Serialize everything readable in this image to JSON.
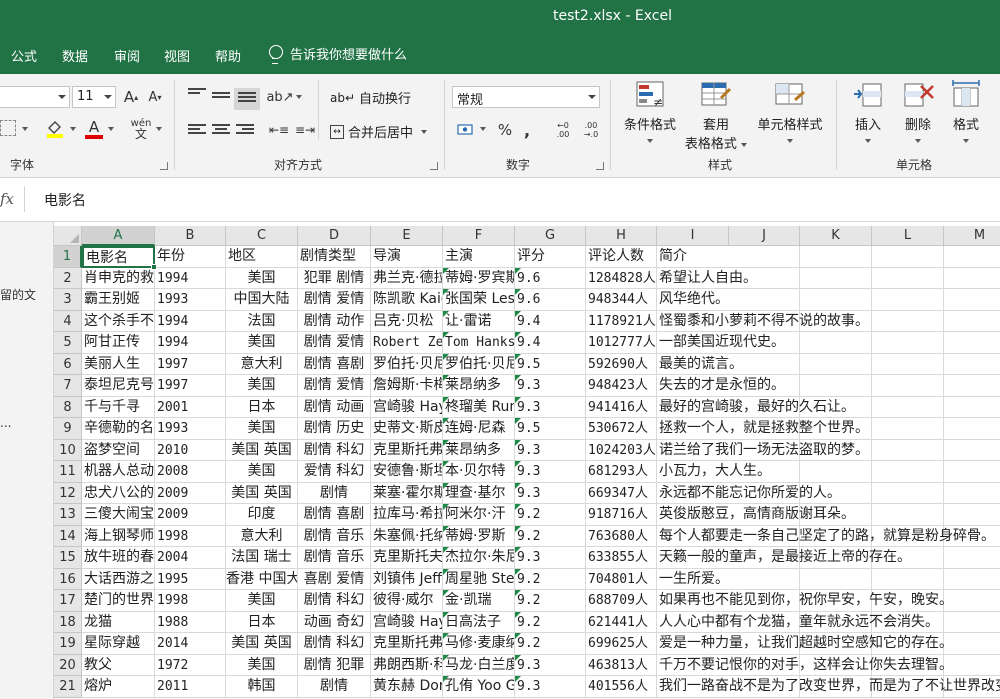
{
  "window": {
    "title": "test2.xlsx  -  Excel"
  },
  "menu": {
    "tabs": [
      "公式",
      "数据",
      "审阅",
      "视图",
      "帮助"
    ],
    "tell_me": "告诉我你想要做什么"
  },
  "ribbon": {
    "font_size": "11",
    "font_group": "字体",
    "wrap_text": "自动换行",
    "merge_center": "合并后居中",
    "align_group": "对齐方式",
    "number_format": "常规",
    "percent": "%",
    "comma": ",",
    "number_group": "数字",
    "cond_format": "条件格式",
    "table_format_1": "套用",
    "table_format_2": "表格格式",
    "cell_style": "单元格样式",
    "style_group": "样式",
    "insert": "插入",
    "delete": "删除",
    "format": "格式",
    "cells_group": "单元格"
  },
  "formula": {
    "fx": "fx",
    "value": "电影名"
  },
  "left_pane": {
    "items": [
      "留的文",
      "..."
    ]
  },
  "sheet": {
    "columns": [
      "A",
      "B",
      "C",
      "D",
      "E",
      "F",
      "G",
      "H",
      "I",
      "J",
      "K",
      "L",
      "M"
    ],
    "rows": [
      {
        "n": "1",
        "a": "电影名",
        "b": "年份",
        "c": "地区",
        "d": "剧情类型",
        "e": "导演",
        "f": "主演",
        "g": "评分",
        "h": "评论人数",
        "i": "简介"
      },
      {
        "n": "2",
        "a": "肖申克的救赎",
        "b": "1994",
        "c": "美国",
        "d": "犯罪 剧情",
        "e": "弗兰克·德拉邦特",
        "f": "蒂姆·罗宾斯",
        "g": "9.6",
        "h": "1284828人",
        "i": "希望让人自由。"
      },
      {
        "n": "3",
        "a": "霸王别姬",
        "b": "1993",
        "c": "中国大陆",
        "d": "剧情 爱情",
        "e": "陈凯歌 Kaige",
        "f": "张国荣 Leslie",
        "g": "9.6",
        "h": "948344人",
        "i": "风华绝代。"
      },
      {
        "n": "4",
        "a": "这个杀手不太冷",
        "b": "1994",
        "c": "法国",
        "d": "剧情 动作",
        "e": "吕克·贝松",
        "f": "让·雷诺",
        "g": "9.4",
        "h": "1178921人",
        "i": "怪蜀黍和小萝莉不得不说的故事。"
      },
      {
        "n": "5",
        "a": "阿甘正传",
        "b": "1994",
        "c": "美国",
        "d": "剧情 爱情",
        "e": "Robert Zemeckis",
        "f": "Tom Hanks",
        "g": "9.4",
        "h": "1012777人",
        "i": "一部美国近现代史。"
      },
      {
        "n": "6",
        "a": "美丽人生",
        "b": "1997",
        "c": "意大利",
        "d": "剧情 喜剧",
        "e": "罗伯托·贝尼尼",
        "f": "罗伯托·贝尼尼",
        "g": "9.5",
        "h": "592690人",
        "i": "最美的谎言。"
      },
      {
        "n": "7",
        "a": "泰坦尼克号",
        "b": "1997",
        "c": "美国",
        "d": "剧情 爱情",
        "e": "詹姆斯·卡梅隆",
        "f": "莱昂纳多",
        "g": "9.3",
        "h": "948423人",
        "i": "失去的才是永恒的。"
      },
      {
        "n": "8",
        "a": "千与千寻",
        "b": "2001",
        "c": "日本",
        "d": "剧情 动画",
        "e": "宫崎骏 Hayao",
        "f": "柊瑠美 Rumi",
        "g": "9.3",
        "h": "941416人",
        "i": "最好的宫崎骏，最好的久石让。"
      },
      {
        "n": "9",
        "a": "辛德勒的名单",
        "b": "1993",
        "c": "美国",
        "d": "剧情 历史",
        "e": "史蒂文·斯皮尔伯格",
        "f": "连姆·尼森",
        "g": "9.5",
        "h": "530672人",
        "i": "拯救一个人，就是拯救整个世界。"
      },
      {
        "n": "10",
        "a": "盗梦空间",
        "b": "2010",
        "c": "美国 英国",
        "d": "剧情 科幻",
        "e": "克里斯托弗·诺兰",
        "f": "莱昂纳多",
        "g": "9.3",
        "h": "1024203人",
        "i": "诺兰给了我们一场无法盗取的梦。"
      },
      {
        "n": "11",
        "a": "机器人总动员",
        "b": "2008",
        "c": "美国",
        "d": "爱情 科幻",
        "e": "安德鲁·斯坦顿",
        "f": "本·贝尔特",
        "g": "9.3",
        "h": "681293人",
        "i": "小瓦力，大人生。"
      },
      {
        "n": "12",
        "a": "忠犬八公的故事",
        "b": "2009",
        "c": "美国 英国",
        "d": "剧情",
        "e": "莱塞·霍尔斯道姆",
        "f": "理查·基尔",
        "g": "9.3",
        "h": "669347人",
        "i": "永远都不能忘记你所爱的人。"
      },
      {
        "n": "13",
        "a": "三傻大闹宝莱坞",
        "b": "2009",
        "c": "印度",
        "d": "剧情 喜剧",
        "e": "拉库马·希拉尼",
        "f": "阿米尔·汗",
        "g": "9.2",
        "h": "918716人",
        "i": "英俊版憨豆，高情商版谢耳朵。"
      },
      {
        "n": "14",
        "a": "海上钢琴师",
        "b": "1998",
        "c": "意大利",
        "d": "剧情 音乐",
        "e": "朱塞佩·托纳多雷",
        "f": "蒂姆·罗斯",
        "g": "9.2",
        "h": "763680人",
        "i": "每个人都要走一条自己坚定了的路，就算是粉身碎骨。"
      },
      {
        "n": "15",
        "a": "放牛班的春天",
        "b": "2004",
        "c": "法国 瑞士",
        "d": "剧情 音乐",
        "e": "克里斯托夫·巴拉蒂",
        "f": "杰拉尔·朱尼奥",
        "g": "9.3",
        "h": "633855人",
        "i": "天籁一般的童声，是最接近上帝的存在。"
      },
      {
        "n": "16",
        "a": "大话西游之大圣娶亲",
        "b": "1995",
        "c": "香港 中国大陆",
        "d": "喜剧 爱情",
        "e": "刘镇伟 Jeffrey",
        "f": "周星驰 Stephen",
        "g": "9.2",
        "h": "704801人",
        "i": "一生所爱。"
      },
      {
        "n": "17",
        "a": "楚门的世界",
        "b": "1998",
        "c": "美国",
        "d": "剧情 科幻",
        "e": "彼得·威尔",
        "f": "金·凯瑞",
        "g": "9.2",
        "h": "688709人",
        "i": "如果再也不能见到你，祝你早安，午安，晚安。"
      },
      {
        "n": "18",
        "a": "龙猫",
        "b": "1988",
        "c": "日本",
        "d": "动画 奇幻",
        "e": "宫崎骏 Hayao",
        "f": "日高法子",
        "g": "9.2",
        "h": "621441人",
        "i": "人人心中都有个龙猫，童年就永远不会消失。"
      },
      {
        "n": "19",
        "a": "星际穿越",
        "b": "2014",
        "c": "美国 英国",
        "d": "剧情 科幻",
        "e": "克里斯托弗·诺兰",
        "f": "马修·麦康纳",
        "g": "9.2",
        "h": "699625人",
        "i": "爱是一种力量，让我们超越时空感知它的存在。"
      },
      {
        "n": "20",
        "a": "教父",
        "b": "1972",
        "c": "美国",
        "d": "剧情 犯罪",
        "e": "弗朗西斯·科波拉",
        "f": "马龙·白兰度",
        "g": "9.3",
        "h": "463813人",
        "i": "千万不要记恨你的对手，这样会让你失去理智。"
      },
      {
        "n": "21",
        "a": "熔炉",
        "b": "2011",
        "c": "韩国",
        "d": "剧情",
        "e": "黄东赫 Dong-hyuk",
        "f": "孔侑 Yoo Gong",
        "g": "9.3",
        "h": "401556人",
        "i": "我们一路奋战不是为了改变世界，而是为了不让世界改变我们。"
      }
    ]
  }
}
